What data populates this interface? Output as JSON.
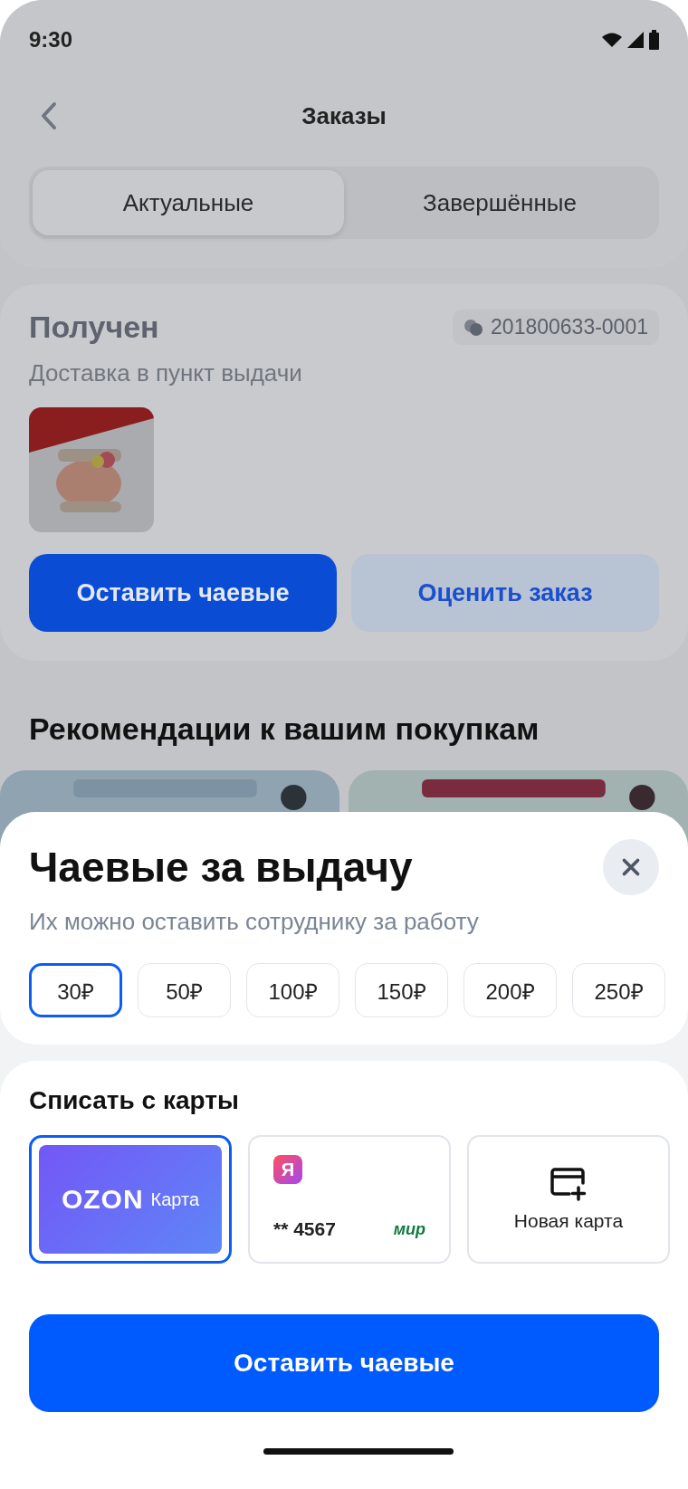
{
  "status_bar": {
    "time": "9:30"
  },
  "header": {
    "title": "Заказы"
  },
  "tabs": [
    {
      "label": "Актуальные",
      "selected": true
    },
    {
      "label": "Завершённые",
      "selected": false
    }
  ],
  "order": {
    "status": "Получен",
    "number": "201800633-0001",
    "delivery": "Доставка в пункт выдачи",
    "buttons": [
      {
        "label": "Оставить чаевые",
        "kind": "primary"
      },
      {
        "label": "Оценить заказ",
        "kind": "secondary"
      }
    ]
  },
  "recommendations": {
    "title": "Рекомендации к вашим покупкам"
  },
  "tip_sheet": {
    "title": "Чаевые за выдачу",
    "subtitle": "Их можно оставить сотруднику за работу",
    "amounts": [
      {
        "label": "30₽",
        "selected": true
      },
      {
        "label": "50₽",
        "selected": false
      },
      {
        "label": "100₽",
        "selected": false
      },
      {
        "label": "150₽",
        "selected": false
      },
      {
        "label": "200₽",
        "selected": false
      },
      {
        "label": "250₽",
        "selected": false
      }
    ],
    "payment_title": "Списать с карты",
    "cards": [
      {
        "kind": "ozon",
        "brand": "OZON",
        "label": "Карта",
        "selected": true
      },
      {
        "kind": "bank",
        "bank_logo": "Я",
        "number": "** 4567",
        "network": "мир",
        "selected": false
      },
      {
        "kind": "new",
        "label": "Новая карта",
        "selected": false
      }
    ],
    "submit": "Оставить чаевые"
  }
}
